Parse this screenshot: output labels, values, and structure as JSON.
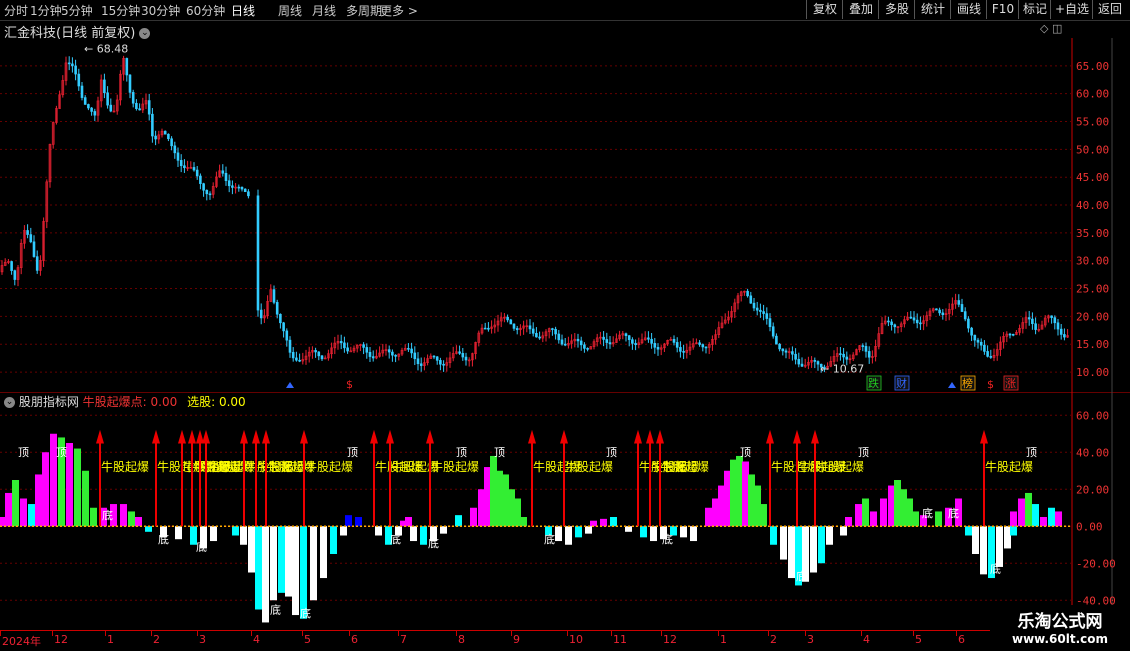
{
  "toolbar": {
    "periods": [
      "分时",
      "1分钟",
      "5分钟",
      "15分钟",
      "30分钟",
      "60分钟",
      "日线",
      "周线",
      "月线",
      "多周期",
      "更多 >"
    ],
    "active_period": "日线",
    "right_buttons": [
      "复权",
      "叠加",
      "多股",
      "统计",
      "画线",
      "F10",
      "标记",
      "+自选",
      "返回"
    ]
  },
  "main_chart": {
    "title": "汇金科技(日线 前复权)",
    "high_label": "68.48",
    "low_label": "10.67",
    "y_ticks": [
      "65.00",
      "60.00",
      "55.00",
      "50.00",
      "45.00",
      "40.00",
      "35.00",
      "30.00",
      "25.00",
      "20.00",
      "15.00",
      "10.00"
    ],
    "y_min": 7.5,
    "y_max": 70,
    "markers": [
      {
        "label": "跌",
        "color": "#2c2"
      },
      {
        "label": "财",
        "color": "#36f"
      },
      {
        "label": "榜",
        "color": "#fa0"
      },
      {
        "label": "$",
        "color": "#e22"
      },
      {
        "label": "涨",
        "color": "#e22"
      }
    ]
  },
  "indicator": {
    "title": "股朋指标网",
    "series1_label": "牛股起爆点:",
    "series1_value": "0.00",
    "series2_label": "选股:",
    "series2_value": "0.00",
    "signal_text": "牛股起爆",
    "top_text": "顶",
    "bottom_text": "底",
    "y_ticks": [
      "60.00",
      "40.00",
      "20.00",
      "0.00",
      "-20.00",
      "-40.00"
    ],
    "y_min": -55,
    "y_max": 65
  },
  "time_axis": {
    "labels": [
      "2024年",
      "12",
      "1",
      "2",
      "3",
      "4",
      "5",
      "6",
      "7",
      "8",
      "9",
      "10",
      "11",
      "12",
      "1",
      "2",
      "3",
      "4",
      "5",
      "6"
    ]
  },
  "watermark": {
    "title": "乐淘公式网",
    "url": "www.60lt.com"
  },
  "colors": {
    "up": "#e23",
    "down": "#3cf",
    "magenta": "#f0f",
    "green": "#3e3",
    "cyan": "#0ff",
    "white": "#fff",
    "yellow": "#ff0",
    "grid": "#700"
  }
}
